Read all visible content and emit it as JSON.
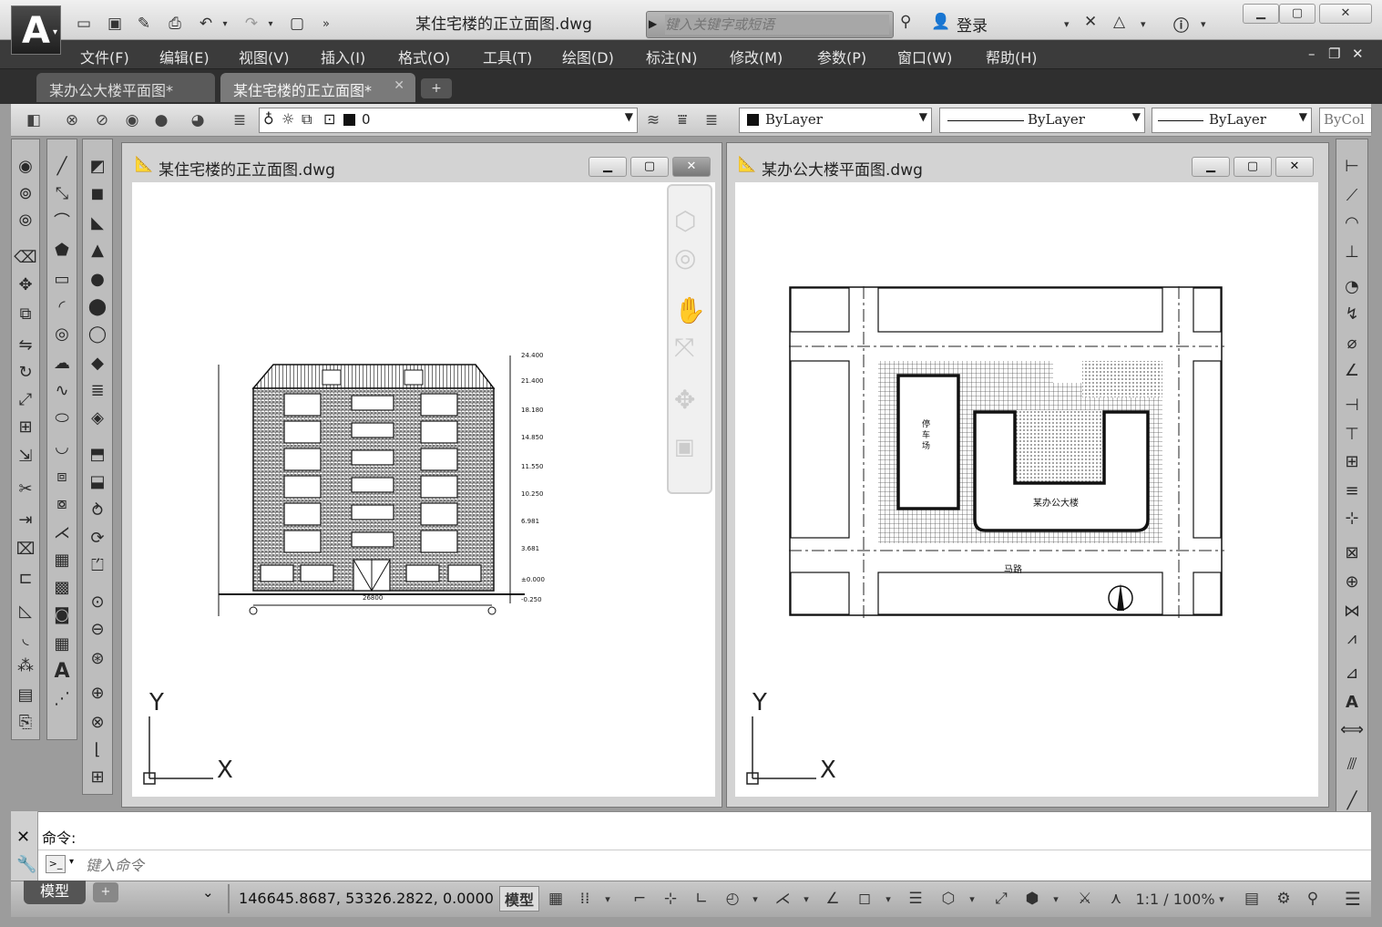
{
  "app": {
    "logo": "A",
    "window_title": "某住宅楼的正立面图.dwg"
  },
  "search": {
    "placeholder": "键入关键字或短语"
  },
  "user": {
    "signin_label": "登录"
  },
  "menu": {
    "items": [
      "文件(F)",
      "编辑(E)",
      "视图(V)",
      "插入(I)",
      "格式(O)",
      "工具(T)",
      "绘图(D)",
      "标注(N)",
      "修改(M)",
      "参数(P)",
      "窗口(W)",
      "帮助(H)"
    ]
  },
  "tabs": [
    {
      "label": "某办公大楼平面图*"
    },
    {
      "label": "某住宅楼的正立面图*"
    }
  ],
  "properties": {
    "layer": "0",
    "color": "ByLayer",
    "linetype": "ByLayer",
    "lineweight": "ByLayer",
    "plotstyle": "ByCol"
  },
  "windows": [
    {
      "title": "某住宅楼的正立面图.dwg"
    },
    {
      "title": "某办公大楼平面图.dwg"
    }
  ],
  "drawing_elevation": {
    "elevation_marks": [
      "24.400",
      "21.400",
      "18.180",
      "14.850",
      "11.550",
      "10.250",
      "6.981",
      "3.681",
      "±0.000",
      "-0.250"
    ],
    "dimension": "26800"
  },
  "drawing_plan": {
    "parking_label": "停车场",
    "building_label": "某办公大楼",
    "road_label": "马路"
  },
  "ucs": {
    "y": "Y",
    "x": "X"
  },
  "command": {
    "history": "命令:",
    "placeholder": "键入命令"
  },
  "layout_tabs": {
    "model": "模型"
  },
  "status": {
    "coordinates": "146645.8687, 53326.2822, 0.0000",
    "model_label": "模型",
    "scale": "1:1 / 100%"
  },
  "colors": {
    "title_bar": "#e0e0e0",
    "menu_bar": "#3b3b3b",
    "canvas": "#ffffff",
    "frame": "#9c9c9c"
  }
}
